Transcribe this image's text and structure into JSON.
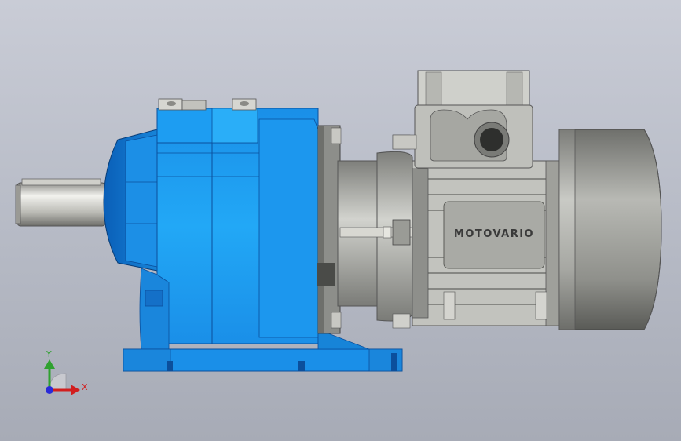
{
  "viewport": {
    "background_top": "#c9ccd6",
    "background_bottom": "#a7abb6"
  },
  "model": {
    "brand_label": "MOTOVARIO",
    "gear_color": "#1f9bf0",
    "gear_dark": "#0b67c4",
    "motor_color": "#a9aaa6",
    "shaft_color": "#d8d8d2"
  },
  "triad": {
    "y_label": "Y",
    "x_label": "X",
    "icons": [
      "y-axis-arrow-icon",
      "x-axis-arrow-icon",
      "z-axis-dot-icon"
    ]
  }
}
